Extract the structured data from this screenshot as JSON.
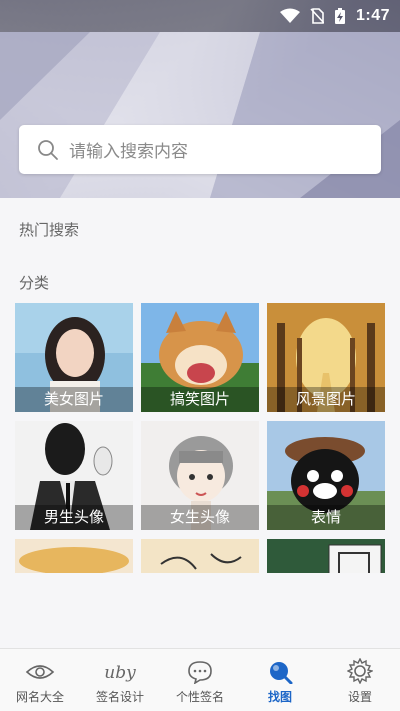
{
  "status_bar": {
    "time": "1:47"
  },
  "search": {
    "placeholder": "请输入搜索内容"
  },
  "sections": {
    "hot_search": "热门搜索",
    "categories": "分类"
  },
  "categories": [
    {
      "label": "美女图片",
      "icon": "portrait-woman-photo"
    },
    {
      "label": "搞笑图片",
      "icon": "laughing-dog-photo"
    },
    {
      "label": "风景图片",
      "icon": "tree-path-photo"
    },
    {
      "label": "男生头像",
      "icon": "man-suit-photo"
    },
    {
      "label": "女生头像",
      "icon": "girl-illustration"
    },
    {
      "label": "表情",
      "icon": "kumamon-bear-photo"
    },
    {
      "label": "",
      "icon": "dessert-photo"
    },
    {
      "label": "",
      "icon": "calligraphy-photo"
    },
    {
      "label": "",
      "icon": "green-plant-photo"
    }
  ],
  "tabbar": {
    "items": [
      {
        "label": "网名大全",
        "icon": "eye-icon"
      },
      {
        "label": "签名设计",
        "icon": "signature-icon",
        "icon_text": "uby"
      },
      {
        "label": "个性签名",
        "icon": "chat-bubble-icon"
      },
      {
        "label": "找图",
        "icon": "search-icon"
      },
      {
        "label": "设置",
        "icon": "gear-icon"
      }
    ],
    "active_index": 3,
    "active_color": "#1d66c7"
  }
}
